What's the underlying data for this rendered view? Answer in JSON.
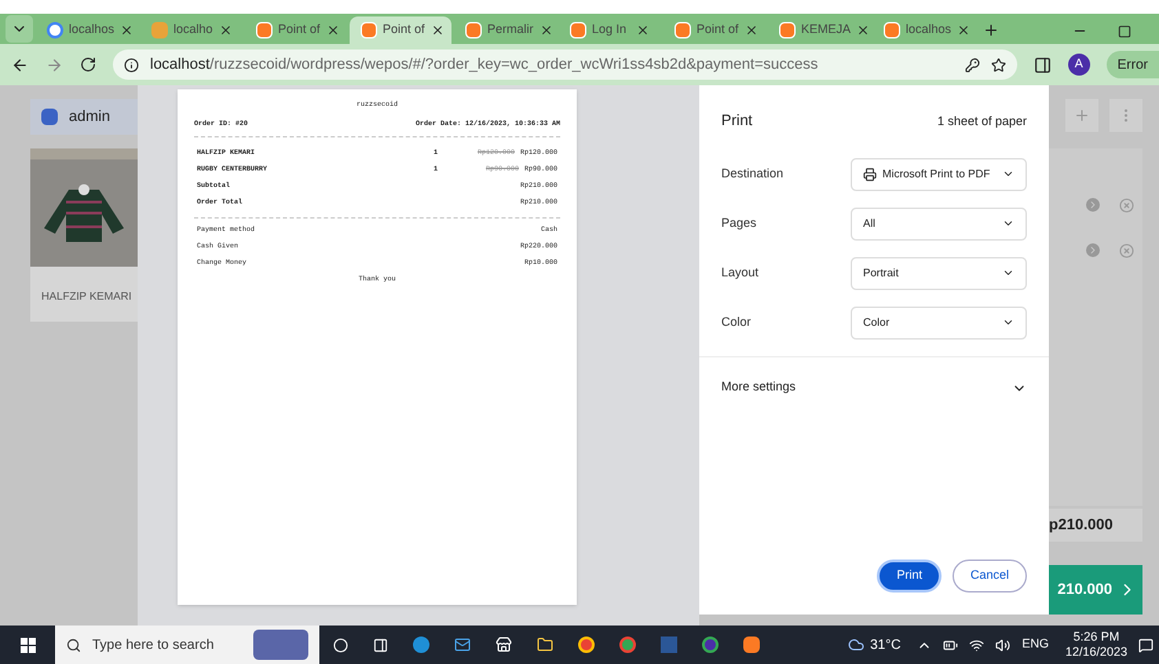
{
  "tabs": [
    {
      "title": "localhos",
      "kind": "google",
      "selected": false
    },
    {
      "title": "localho",
      "kind": "site",
      "selected": false
    },
    {
      "title": "Point of",
      "kind": "xampp",
      "selected": false
    },
    {
      "title": "Point of",
      "kind": "xampp",
      "selected": true
    },
    {
      "title": "Permalir",
      "kind": "xampp",
      "selected": false
    },
    {
      "title": "Log In",
      "kind": "xampp",
      "selected": false
    },
    {
      "title": "Point of",
      "kind": "xampp",
      "selected": false
    },
    {
      "title": "KEMEJA",
      "kind": "xampp",
      "selected": false
    },
    {
      "title": "localhos",
      "kind": "xampp",
      "selected": false
    }
  ],
  "address": {
    "host": "localhost",
    "path": "/ruzzsecoid/wordpress/wepos/#/?order_key=wc_order_wcWri1ss4sb2d&payment=success"
  },
  "profile": "A",
  "error_button": "Error",
  "app": {
    "user": "admin",
    "product": {
      "name": "HALFZIP KEMARI"
    },
    "total_partial": "p210.000",
    "pay_partial": "210.000"
  },
  "receipt": {
    "store": "ruzzsecoid",
    "order_id": "Order ID: #20",
    "order_date": "Order Date: 12/16/2023, 10:36:33 AM",
    "items": [
      {
        "name": "HALFZIP KEMARI",
        "qty": "1",
        "old_price": "Rp120.000",
        "price": "Rp120.000"
      },
      {
        "name": "RUGBY CENTERBURRY",
        "qty": "1",
        "old_price": "Rp90.000",
        "price": "Rp90.000"
      }
    ],
    "totals": [
      {
        "label": "Subtotal",
        "value": "Rp210.000"
      },
      {
        "label": "Order Total",
        "value": "Rp210.000"
      }
    ],
    "payment": [
      {
        "label": "Payment method",
        "value": "Cash"
      },
      {
        "label": "Cash Given",
        "value": "Rp220.000"
      },
      {
        "label": "Change Money",
        "value": "Rp10.000"
      }
    ],
    "footer": "Thank you"
  },
  "print": {
    "title": "Print",
    "sheets": "1 sheet of paper",
    "settings": [
      {
        "label": "Destination",
        "value": "Microsoft Print to PDF",
        "kind": "printer"
      },
      {
        "label": "Pages",
        "value": "All",
        "kind": "select"
      },
      {
        "label": "Layout",
        "value": "Portrait",
        "kind": "select"
      },
      {
        "label": "Color",
        "value": "Color",
        "kind": "select"
      }
    ],
    "more": "More settings",
    "print_button": "Print",
    "cancel_button": "Cancel"
  },
  "taskbar": {
    "search_placeholder": "Type here to search",
    "temp": "31°C",
    "lang": "ENG",
    "time": "5:26 PM",
    "date": "12/16/2023"
  }
}
